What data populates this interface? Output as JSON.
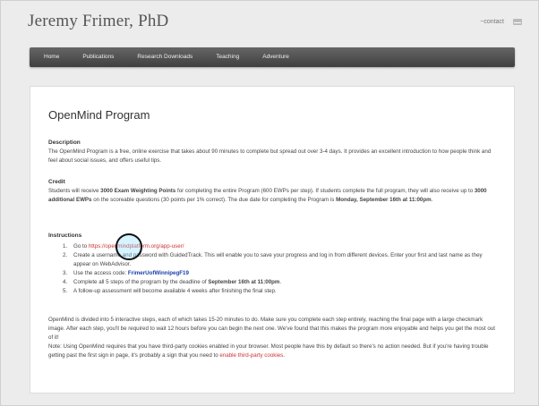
{
  "header": {
    "site_title": "Jeremy Frimer, PhD",
    "contact_label": "~contact",
    "mail_icon": "mail-icon"
  },
  "nav": {
    "items": [
      {
        "label": "Home"
      },
      {
        "label": "Publications"
      },
      {
        "label": "Research Downloads"
      },
      {
        "label": "Teaching"
      },
      {
        "label": "Adventure"
      }
    ]
  },
  "page": {
    "title": "OpenMind Program",
    "description": {
      "heading": "Description",
      "text": "The OpenMind Program is a free, online exercise that takes about 90 minutes to complete but spread out over 3-4 days. It provides an excellent introduction to how people think and feel about social issues, and offers useful tips."
    },
    "credit": {
      "heading": "Credit",
      "t1": "Students will receive ",
      "b1": "3000 Exam Weighting Points",
      "t2": " for completing the entire Program (600 EWPs per step). If students complete the full program, they will also receive up to ",
      "b2": "3000 additional EWPs",
      "t3": " on the scoreable questions (30 points per 1% correct).  The due date for completing the Program is ",
      "b3": "Monday, September 16th at 11:00pm",
      "t4": "."
    },
    "instructions": {
      "heading": "Instructions",
      "i1_num": "1.",
      "i1_text": "Go to ",
      "i1_link": "https://openmindplatform.org/app-user/",
      "i2_num": "2.",
      "i2_text": "Create a username and password with GuidedTrack. This will enable you to save your progress and log in from different devices. Enter your first and last name as they appear on WebAdvisor.",
      "i3_num": "3.",
      "i3_text": "Use the access code: ",
      "i3_code": "FrimerUofWinnipegF19",
      "i4_num": "4.",
      "i4_text": "Complete all 5 steps of the program by the deadline of ",
      "i4_bold": "September 16th at 11:00pm",
      "i4_end": ".",
      "i5_num": "5.",
      "i5_text": "A follow-up assessment will become available 4 weeks after finishing the final step."
    },
    "para1": "OpenMind is divided into 5 interactive steps, each of which takes 15-20 minutes to do. Make sure you complete each step entirely, reaching the final page with a large checkmark image. After each step, you'll be required to wait 12 hours before you can begin the next one. We've found that this makes the program more enjoyable and helps you get the most out of it!",
    "note_text": "Note: Using OpenMind requires that you have third-party cookies enabled in your browser. Most people have this by default so there's no action needed. But if you're having trouble getting past the first sign in page, it's probably a sign that you need to ",
    "note_link": "enable third-party cookies",
    "note_end": "."
  },
  "colors": {
    "nav_bg": "#4a4a4a",
    "link_red": "#cc3333",
    "code_blue": "#1a3ea8",
    "cursor_highlight": "#8cdcff"
  }
}
